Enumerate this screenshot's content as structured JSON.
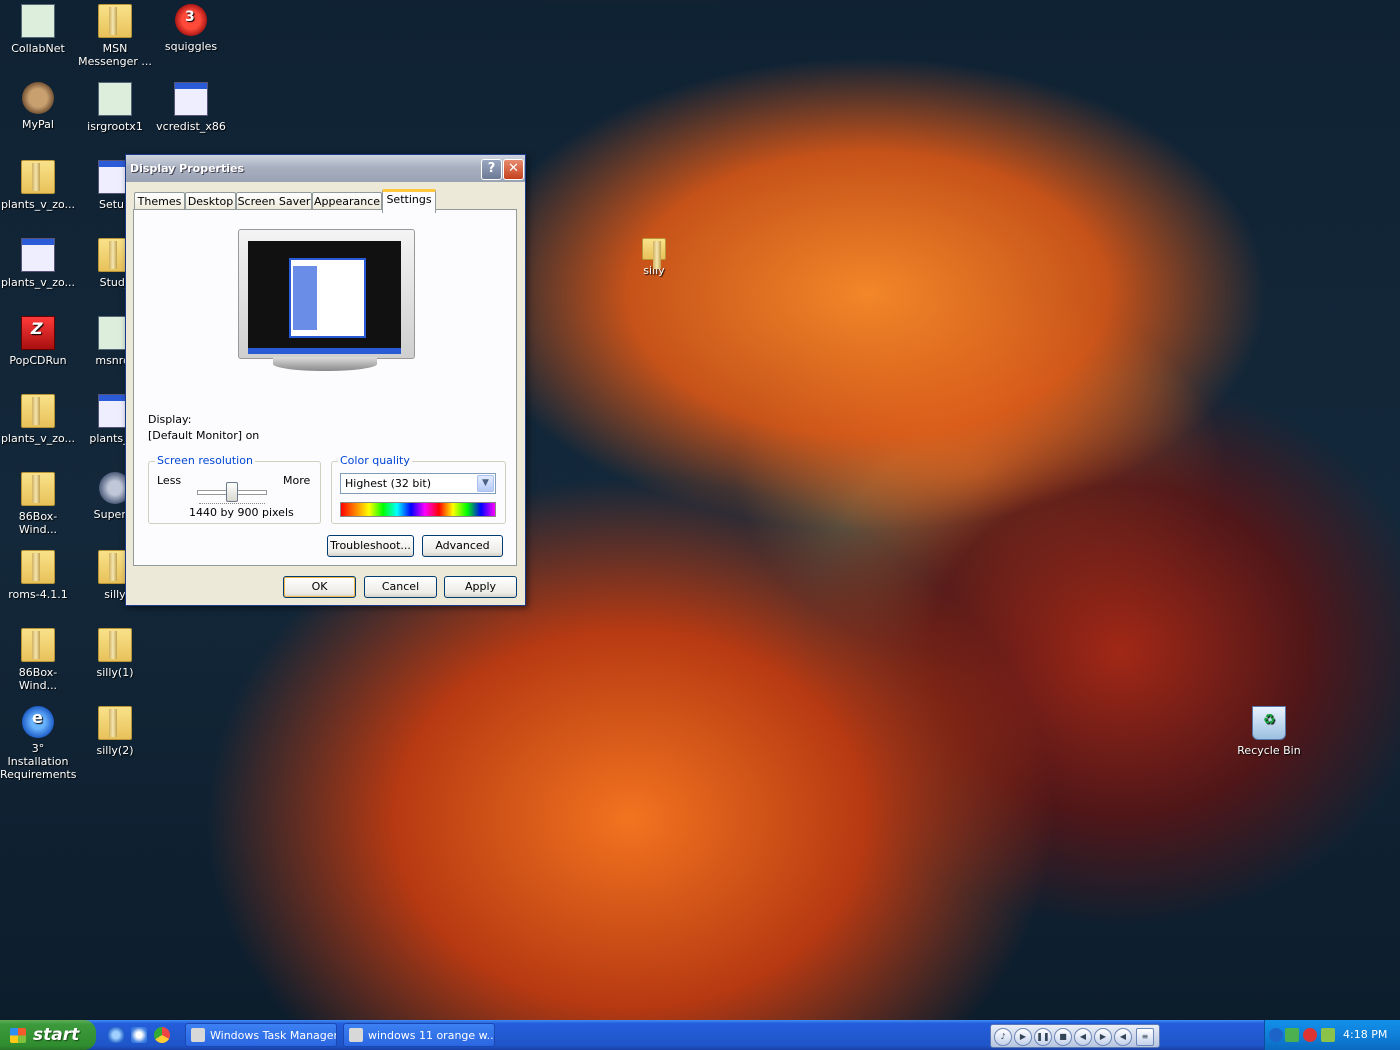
{
  "desktop": {
    "icons": [
      {
        "label": "CollabNet"
      },
      {
        "label": "MSN Messenger ..."
      },
      {
        "label": "squiggles"
      },
      {
        "label": "MyPal"
      },
      {
        "label": "isrgrootx1"
      },
      {
        "label": "vcredist_x86"
      },
      {
        "label": "plants_v_zo..."
      },
      {
        "label": "Setup"
      },
      {
        "label": "plants_v_zo..."
      },
      {
        "label": "Stud_"
      },
      {
        "label": "PopCDRun"
      },
      {
        "label": "msnrdr"
      },
      {
        "label": "plants_v_zo..."
      },
      {
        "label": "plants_v_"
      },
      {
        "label": "86Box-Wind..."
      },
      {
        "label": "Superm"
      },
      {
        "label": "roms-4.1.1"
      },
      {
        "label": "silly"
      },
      {
        "label": "86Box-Wind..."
      },
      {
        "label": "silly(1)"
      },
      {
        "label": "3° Installation Requirements"
      },
      {
        "label": "silly(2)"
      },
      {
        "label": "silly"
      },
      {
        "label": "Recycle Bin"
      }
    ]
  },
  "dialog": {
    "title": "Display Properties",
    "help_glyph": "?",
    "close_glyph": "✕",
    "tabs": [
      "Themes",
      "Desktop",
      "Screen Saver",
      "Appearance",
      "Settings"
    ],
    "active_tab": "Settings",
    "display_label": "Display:",
    "display_value": "[Default Monitor] on",
    "screen_resolution": {
      "title": "Screen resolution",
      "less": "Less",
      "more": "More",
      "value_text": "1440 by 900 pixels"
    },
    "color_quality": {
      "title": "Color quality",
      "selected": "Highest (32 bit)",
      "arrow": "▼"
    },
    "buttons": {
      "troubleshoot": "Troubleshoot...",
      "advanced": "Advanced",
      "ok": "OK",
      "cancel": "Cancel",
      "apply": "Apply"
    }
  },
  "taskbar": {
    "start_label": "start",
    "tasks": [
      {
        "label": "Windows Task Manager"
      },
      {
        "label": "windows 11 orange w..."
      }
    ],
    "clock": "4:18 PM"
  },
  "colors": {
    "accent": "#245edb",
    "start_green": "#3c9a3c",
    "tab_highlight": "#ffc83c",
    "group_title": "#0046d5"
  }
}
